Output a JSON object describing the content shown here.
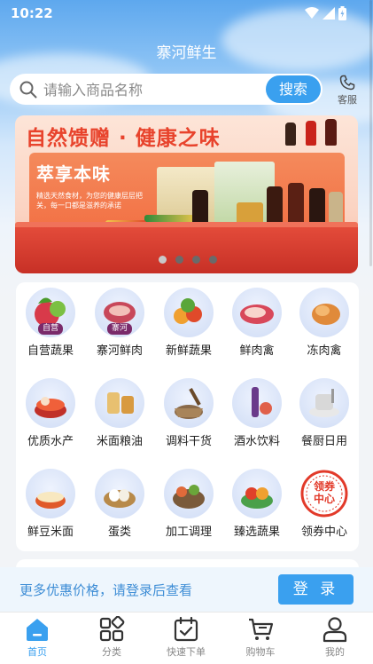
{
  "status_bar": {
    "time": "10:22"
  },
  "header": {
    "title": "寨河鲜生"
  },
  "search": {
    "placeholder": "请输入商品名称",
    "button_label": "搜索"
  },
  "service": {
    "label": "客服"
  },
  "banner": {
    "headline": "自然馈赠 · 健康之味",
    "subtitle": "萃享本味",
    "description": "精选天然食材，为您的健康层层把关，每一口都是滋养的承诺",
    "slide_count": 4,
    "active_slide": 1
  },
  "categories": [
    {
      "label": "自营蔬果",
      "icon": "vegetables-basket-icon",
      "badge": "自营"
    },
    {
      "label": "寨河鲜肉",
      "icon": "fresh-meat-icon",
      "badge": "寨河"
    },
    {
      "label": "新鲜蔬果",
      "icon": "fresh-produce-icon"
    },
    {
      "label": "鲜肉禽",
      "icon": "meat-poultry-icon"
    },
    {
      "label": "冻肉禽",
      "icon": "frozen-poultry-icon"
    },
    {
      "label": "优质水产",
      "icon": "seafood-hotpot-icon"
    },
    {
      "label": "米面粮油",
      "icon": "grain-oil-icon"
    },
    {
      "label": "调料干货",
      "icon": "seasoning-mortar-icon"
    },
    {
      "label": "酒水饮料",
      "icon": "wine-drinks-icon"
    },
    {
      "label": "餐厨日用",
      "icon": "kitchenware-icon"
    },
    {
      "label": "鲜豆米面",
      "icon": "noodle-bowl-icon"
    },
    {
      "label": "蛋类",
      "icon": "egg-nest-icon"
    },
    {
      "label": "加工调理",
      "icon": "prepared-food-icon"
    },
    {
      "label": "臻选蔬果",
      "icon": "selected-fruit-icon"
    },
    {
      "label": "领券中心",
      "icon": "coupon-center-icon",
      "badge": "领券\n中心"
    }
  ],
  "login_prompt": {
    "text": "更多优惠价格，请登录后查看",
    "button_label": "登 录"
  },
  "tabbar": [
    {
      "label": "首页",
      "icon": "home-icon",
      "active": true
    },
    {
      "label": "分类",
      "icon": "category-grid-icon",
      "active": false
    },
    {
      "label": "快速下单",
      "icon": "quick-order-icon",
      "active": false
    },
    {
      "label": "购物车",
      "icon": "cart-icon",
      "active": false
    },
    {
      "label": "我的",
      "icon": "profile-icon",
      "active": false
    }
  ],
  "colors": {
    "accent": "#3aa0ef",
    "banner_red": "#e8432c",
    "header_blue": "#5ea8ee"
  }
}
